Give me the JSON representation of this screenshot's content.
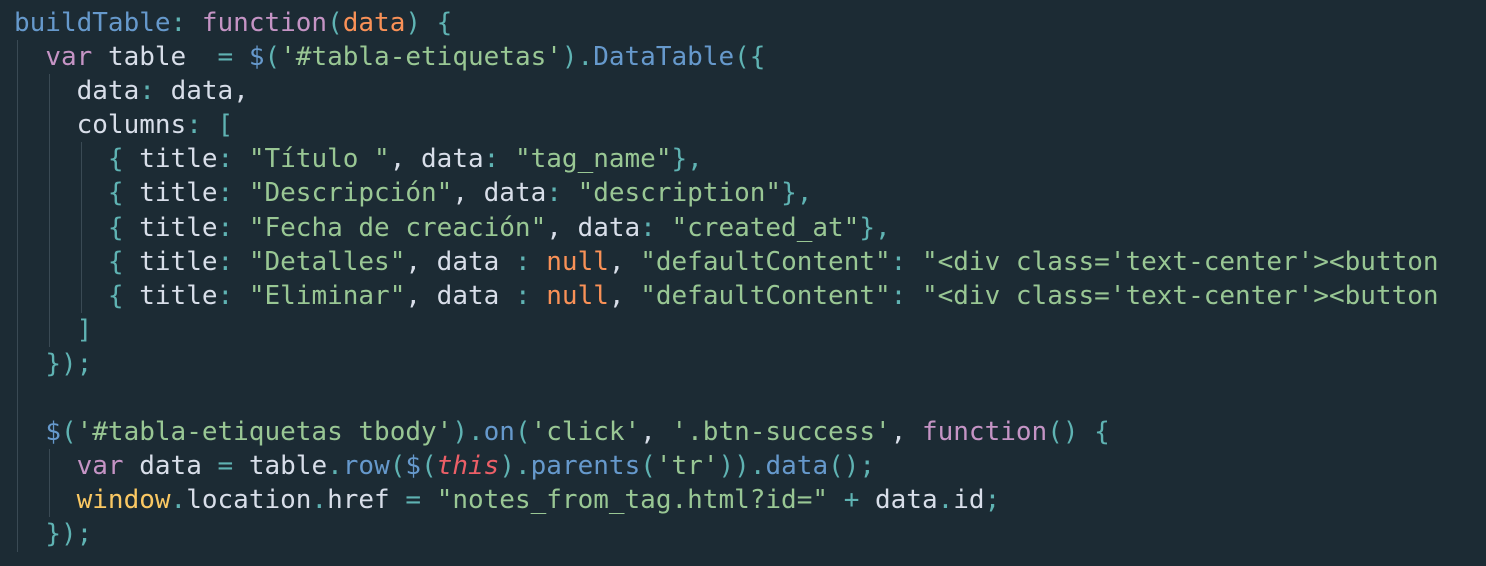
{
  "editor": {
    "colors": {
      "background": "#1c2b34",
      "plain": "#d8dee9",
      "property": "#6699cc",
      "keyword": "#c594c5",
      "param": "#f99157",
      "punctuation": "#5fb3b3",
      "string": "#99c794",
      "function": "#6699cc",
      "null": "#f99157",
      "this": "#ec5f67",
      "global": "#fac863",
      "operator": "#5fb3b3",
      "indent_guide": "#3a4a54"
    },
    "lines": [
      {
        "indent": 0,
        "tokens": [
          {
            "t": "prop",
            "v": "buildTable"
          },
          {
            "t": "punct",
            "v": ": "
          },
          {
            "t": "keyword",
            "v": "function"
          },
          {
            "t": "punct",
            "v": "("
          },
          {
            "t": "param",
            "v": "data"
          },
          {
            "t": "punct",
            "v": ") {"
          }
        ]
      },
      {
        "indent": 1,
        "tokens": [
          {
            "t": "keyword",
            "v": "var "
          },
          {
            "t": "plain",
            "v": "table  "
          },
          {
            "t": "operator",
            "v": "= "
          },
          {
            "t": "function",
            "v": "$"
          },
          {
            "t": "punct",
            "v": "("
          },
          {
            "t": "string",
            "v": "'#tabla-etiquetas'"
          },
          {
            "t": "punct",
            "v": ")."
          },
          {
            "t": "function",
            "v": "DataTable"
          },
          {
            "t": "punct",
            "v": "({"
          }
        ]
      },
      {
        "indent": 2,
        "tokens": [
          {
            "t": "plain",
            "v": "data"
          },
          {
            "t": "punct",
            "v": ": "
          },
          {
            "t": "plain",
            "v": "data,"
          }
        ]
      },
      {
        "indent": 2,
        "tokens": [
          {
            "t": "plain",
            "v": "columns"
          },
          {
            "t": "punct",
            "v": ": ["
          }
        ]
      },
      {
        "indent": 3,
        "tokens": [
          {
            "t": "punct",
            "v": "{ "
          },
          {
            "t": "plain",
            "v": "title"
          },
          {
            "t": "punct",
            "v": ": "
          },
          {
            "t": "string",
            "v": "\"Título \""
          },
          {
            "t": "plain",
            "v": ", data"
          },
          {
            "t": "punct",
            "v": ": "
          },
          {
            "t": "string",
            "v": "\"tag_name\""
          },
          {
            "t": "punct",
            "v": "},"
          }
        ]
      },
      {
        "indent": 3,
        "tokens": [
          {
            "t": "punct",
            "v": "{ "
          },
          {
            "t": "plain",
            "v": "title"
          },
          {
            "t": "punct",
            "v": ": "
          },
          {
            "t": "string",
            "v": "\"Descripción\""
          },
          {
            "t": "plain",
            "v": ", data"
          },
          {
            "t": "punct",
            "v": ": "
          },
          {
            "t": "string",
            "v": "\"description\""
          },
          {
            "t": "punct",
            "v": "},"
          }
        ]
      },
      {
        "indent": 3,
        "tokens": [
          {
            "t": "punct",
            "v": "{ "
          },
          {
            "t": "plain",
            "v": "title"
          },
          {
            "t": "punct",
            "v": ": "
          },
          {
            "t": "string",
            "v": "\"Fecha de creación\""
          },
          {
            "t": "plain",
            "v": ", data"
          },
          {
            "t": "punct",
            "v": ": "
          },
          {
            "t": "string",
            "v": "\"created_at\""
          },
          {
            "t": "punct",
            "v": "},"
          }
        ]
      },
      {
        "indent": 3,
        "tokens": [
          {
            "t": "punct",
            "v": "{ "
          },
          {
            "t": "plain",
            "v": "title"
          },
          {
            "t": "punct",
            "v": ": "
          },
          {
            "t": "string",
            "v": "\"Detalles\""
          },
          {
            "t": "plain",
            "v": ", data "
          },
          {
            "t": "punct",
            "v": ": "
          },
          {
            "t": "null",
            "v": "null"
          },
          {
            "t": "plain",
            "v": ", "
          },
          {
            "t": "string",
            "v": "\"defaultContent\""
          },
          {
            "t": "punct",
            "v": ": "
          },
          {
            "t": "string",
            "v": "\"<div class='text-center'><button"
          }
        ]
      },
      {
        "indent": 3,
        "tokens": [
          {
            "t": "punct",
            "v": "{ "
          },
          {
            "t": "plain",
            "v": "title"
          },
          {
            "t": "punct",
            "v": ": "
          },
          {
            "t": "string",
            "v": "\"Eliminar\""
          },
          {
            "t": "plain",
            "v": ", data "
          },
          {
            "t": "punct",
            "v": ": "
          },
          {
            "t": "null",
            "v": "null"
          },
          {
            "t": "plain",
            "v": ", "
          },
          {
            "t": "string",
            "v": "\"defaultContent\""
          },
          {
            "t": "punct",
            "v": ": "
          },
          {
            "t": "string",
            "v": "\"<div class='text-center'><button"
          }
        ]
      },
      {
        "indent": 2,
        "tokens": [
          {
            "t": "punct",
            "v": "]"
          }
        ]
      },
      {
        "indent": 1,
        "tokens": [
          {
            "t": "punct",
            "v": "});"
          }
        ]
      },
      {
        "indent": 0,
        "tokens": [],
        "guides": 1
      },
      {
        "indent": 1,
        "tokens": [
          {
            "t": "function",
            "v": "$"
          },
          {
            "t": "punct",
            "v": "("
          },
          {
            "t": "string",
            "v": "'#tabla-etiquetas tbody'"
          },
          {
            "t": "punct",
            "v": ")."
          },
          {
            "t": "function",
            "v": "on"
          },
          {
            "t": "punct",
            "v": "("
          },
          {
            "t": "string",
            "v": "'click'"
          },
          {
            "t": "plain",
            "v": ", "
          },
          {
            "t": "string",
            "v": "'.btn-success'"
          },
          {
            "t": "plain",
            "v": ", "
          },
          {
            "t": "keyword",
            "v": "function"
          },
          {
            "t": "punct",
            "v": "() {"
          }
        ]
      },
      {
        "indent": 2,
        "tokens": [
          {
            "t": "keyword",
            "v": "var "
          },
          {
            "t": "plain",
            "v": "data "
          },
          {
            "t": "operator",
            "v": "= "
          },
          {
            "t": "plain",
            "v": "table"
          },
          {
            "t": "punct",
            "v": "."
          },
          {
            "t": "function",
            "v": "row"
          },
          {
            "t": "punct",
            "v": "("
          },
          {
            "t": "function",
            "v": "$"
          },
          {
            "t": "punct",
            "v": "("
          },
          {
            "t": "this",
            "v": "this"
          },
          {
            "t": "punct",
            "v": ")."
          },
          {
            "t": "function",
            "v": "parents"
          },
          {
            "t": "punct",
            "v": "("
          },
          {
            "t": "string",
            "v": "'tr'"
          },
          {
            "t": "punct",
            "v": "))."
          },
          {
            "t": "function",
            "v": "data"
          },
          {
            "t": "punct",
            "v": "();"
          }
        ]
      },
      {
        "indent": 2,
        "tokens": [
          {
            "t": "global",
            "v": "window"
          },
          {
            "t": "punct",
            "v": "."
          },
          {
            "t": "plain",
            "v": "location"
          },
          {
            "t": "punct",
            "v": "."
          },
          {
            "t": "plain",
            "v": "href "
          },
          {
            "t": "operator",
            "v": "= "
          },
          {
            "t": "string",
            "v": "\"notes_from_tag.html?id=\""
          },
          {
            "t": "plain",
            "v": " "
          },
          {
            "t": "operator",
            "v": "+ "
          },
          {
            "t": "plain",
            "v": "data"
          },
          {
            "t": "punct",
            "v": "."
          },
          {
            "t": "plain",
            "v": "id"
          },
          {
            "t": "punct",
            "v": ";"
          }
        ]
      },
      {
        "indent": 1,
        "tokens": [
          {
            "t": "punct",
            "v": "});"
          }
        ]
      }
    ]
  }
}
